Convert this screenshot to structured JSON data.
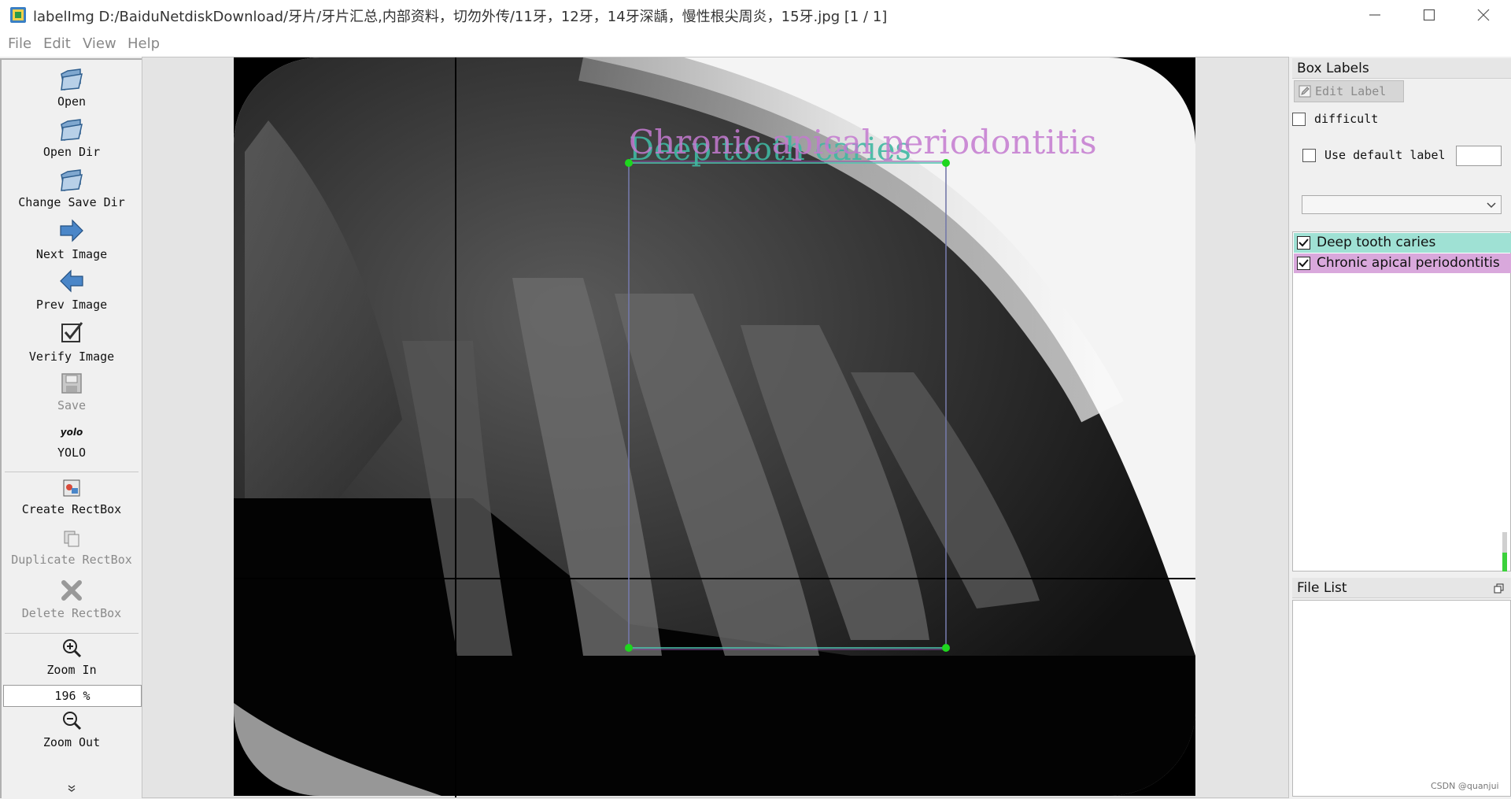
{
  "window": {
    "title": "labelImg D:/BaiduNetdiskDownload/牙片/牙片汇总,内部资料，切勿外传/11牙，12牙，14牙深龋，慢性根尖周炎，15牙.jpg [1 / 1]"
  },
  "menu": [
    "File",
    "Edit",
    "View",
    "Help"
  ],
  "toolbar": {
    "open": "Open",
    "open_dir": "Open Dir",
    "change_save_dir": "Change Save Dir",
    "next_image": "Next Image",
    "prev_image": "Prev Image",
    "verify_image": "Verify Image",
    "save": "Save",
    "format_icon_text": "yolo",
    "format": "YOLO",
    "create_rectbox": "Create RectBox",
    "duplicate_rectbox": "Duplicate RectBox",
    "delete_rectbox": "Delete RectBox",
    "zoom_in": "Zoom In",
    "zoom_value": "196 %",
    "zoom_out": "Zoom Out"
  },
  "canvas": {
    "overlay_labels": [
      "Deep tooth caries",
      "Chronic apical periodontitis"
    ]
  },
  "box_labels": {
    "title": "Box Labels",
    "edit_label": "Edit Label",
    "difficult": "difficult",
    "use_default_label": "Use default label",
    "default_label_value": "",
    "dropdown_value": "",
    "labels": [
      {
        "text": "Deep tooth caries",
        "checked": true,
        "color": "#9fe1d4"
      },
      {
        "text": "Chronic apical periodontitis",
        "checked": true,
        "color": "#d9a8dc"
      }
    ]
  },
  "file_list": {
    "title": "File List"
  },
  "watermark": "CSDN @quanjui"
}
